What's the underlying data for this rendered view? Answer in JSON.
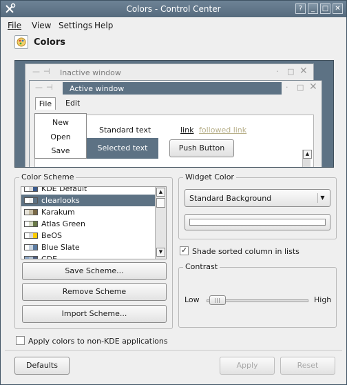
{
  "window": {
    "title": "Colors - Control Center",
    "buttons": [
      "?",
      "_",
      "□",
      "✕"
    ]
  },
  "menubar": [
    "File",
    "View",
    "Settings",
    "Help"
  ],
  "module": {
    "title": "Colors"
  },
  "preview": {
    "inactive_title": "Inactive window",
    "active_title": "Active window",
    "menu": [
      "File",
      "Edit"
    ],
    "file_menu_items": [
      "New",
      "Open",
      "Save"
    ],
    "standard_text": "Standard text",
    "link": "link",
    "followed_link": "followed link",
    "selected_text": "Selected text",
    "push_button": "Push Button"
  },
  "color_scheme": {
    "title": "Color Scheme",
    "items": [
      {
        "label": "KDE Default",
        "colors": [
          "#ffffff",
          "#dcdcdc",
          "#3a5a8c"
        ]
      },
      {
        "label": "clearlooks",
        "colors": [
          "#ffffff",
          "#efefef",
          "#5d7284"
        ],
        "selected": true
      },
      {
        "label": "Karakum",
        "colors": [
          "#e8e4da",
          "#c8c0a8",
          "#7a6a48"
        ]
      },
      {
        "label": "Atlas Green",
        "colors": [
          "#ffffff",
          "#d8dcc8",
          "#6a7a48"
        ]
      },
      {
        "label": "BeOS",
        "colors": [
          "#ffffff",
          "#d8d8d8",
          "#ffcc00"
        ]
      },
      {
        "label": "Blue Slate",
        "colors": [
          "#ffffff",
          "#c8d4e0",
          "#5a7aa0"
        ]
      },
      {
        "label": "CDE",
        "colors": [
          "#8fa8c8",
          "#b0c0d0",
          "#506080"
        ]
      }
    ],
    "save_button": "Save Scheme...",
    "remove_button": "Remove Scheme",
    "import_button": "Import Scheme..."
  },
  "widget_color": {
    "title": "Widget Color",
    "selected": "Standard Background",
    "swatch_color": "#ffffff",
    "shade_sorted_label": "Shade sorted column in lists",
    "shade_sorted_checked": true
  },
  "contrast": {
    "title": "Contrast",
    "low": "Low",
    "high": "High",
    "level": 0.03
  },
  "apply_non_kde": {
    "label": "Apply colors to non-KDE applications",
    "checked": false
  },
  "footer": {
    "defaults": "Defaults",
    "apply": "Apply",
    "reset": "Reset"
  },
  "colors": {
    "accent": "#5d7284",
    "window": "#efefef"
  }
}
